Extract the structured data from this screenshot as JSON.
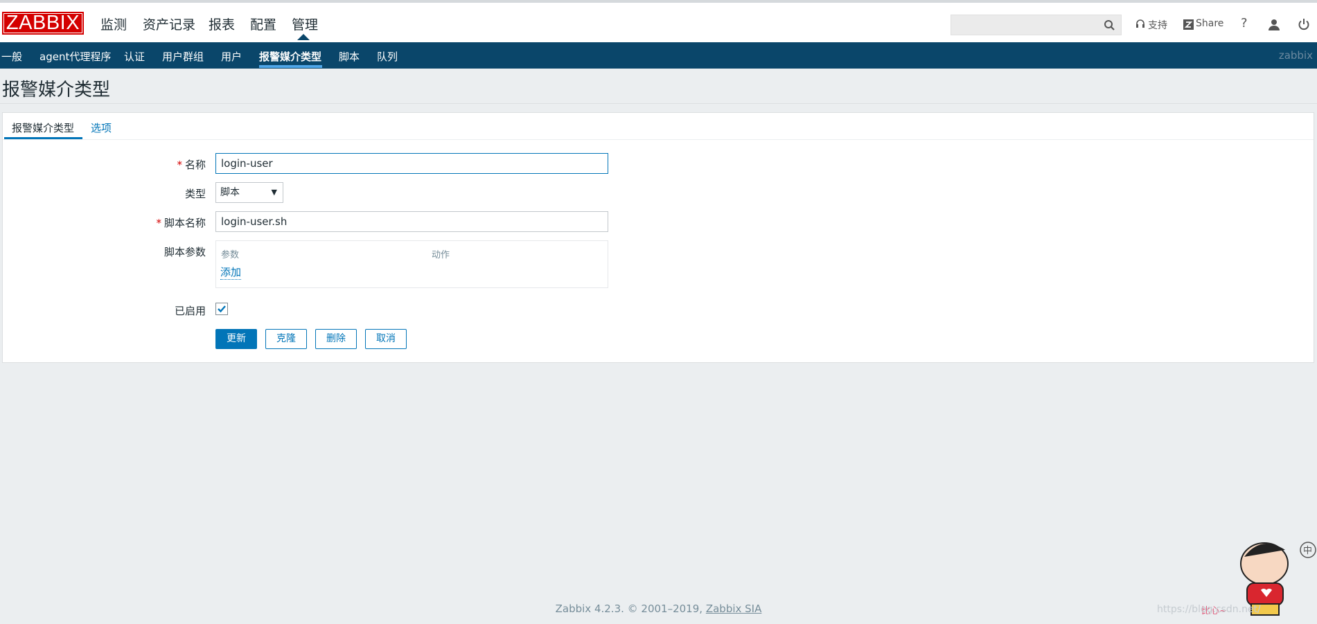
{
  "logo_text": "ZABBIX",
  "main_menu": [
    {
      "label": "监测"
    },
    {
      "label": "资产记录"
    },
    {
      "label": "报表"
    },
    {
      "label": "配置"
    },
    {
      "label": "管理",
      "active": true
    }
  ],
  "header_right": {
    "search_value": "",
    "support_label": "支持",
    "share_label": "Share",
    "help_label": "?"
  },
  "sub_menu": [
    {
      "label": "一般"
    },
    {
      "label": "agent代理程序"
    },
    {
      "label": "认证"
    },
    {
      "label": "用户群组"
    },
    {
      "label": "用户"
    },
    {
      "label": "报警媒介类型",
      "active": true
    },
    {
      "label": "脚本"
    },
    {
      "label": "队列"
    }
  ],
  "server_name": "zabbix",
  "page_title": "报警媒介类型",
  "tabs": [
    {
      "label": "报警媒介类型",
      "active": true
    },
    {
      "label": "选项",
      "active": false
    }
  ],
  "form": {
    "name_label": "名称",
    "name_value": "login-user",
    "type_label": "类型",
    "type_value": "脚本",
    "script_name_label": "脚本名称",
    "script_name_value": "login-user.sh",
    "script_params_label": "脚本参数",
    "params_header_param": "参数",
    "params_header_action": "动作",
    "add_link": "添加",
    "enabled_label": "已启用",
    "enabled": true
  },
  "buttons": {
    "update": "更新",
    "clone": "克隆",
    "delete": "删除",
    "cancel": "取消"
  },
  "footer": {
    "version_text": "Zabbix 4.2.3. © 2001–2019,",
    "company": "Zabbix SIA"
  },
  "watermark": "https://blog.csdn.net/",
  "mascot_text": "比心~",
  "colors": {
    "accent": "#0275b8",
    "nav_bg": "#0a466a",
    "logo_red": "#d40000",
    "required": "#d40000"
  }
}
